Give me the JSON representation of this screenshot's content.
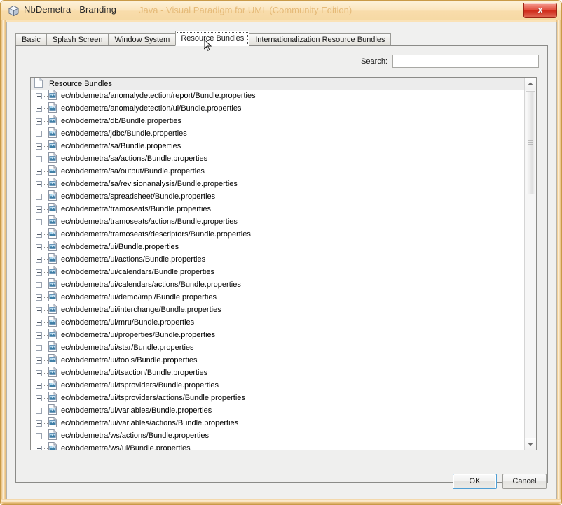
{
  "window": {
    "title": "NbDemetra - Branding",
    "title_icon": "cube-icon",
    "ghost_text": "Java - Visual Paradigm for UML (Community Edition)",
    "close_label": "x"
  },
  "tabs": [
    {
      "label": "Basic",
      "selected": false
    },
    {
      "label": "Splash Screen",
      "selected": false
    },
    {
      "label": "Window System",
      "selected": false
    },
    {
      "label": "Resource Bundles",
      "selected": true
    },
    {
      "label": "Internationalization Resource Bundles",
      "selected": false
    }
  ],
  "search": {
    "label": "Search:",
    "value": "",
    "placeholder": ""
  },
  "tree": {
    "root_label": "Resource Bundles",
    "root_icon": "document-icon",
    "child_icon": "properties-file-icon",
    "handle_icon": "plus-expand-icon",
    "items": [
      "ec/nbdemetra/anomalydetection/report/Bundle.properties",
      "ec/nbdemetra/anomalydetection/ui/Bundle.properties",
      "ec/nbdemetra/db/Bundle.properties",
      "ec/nbdemetra/jdbc/Bundle.properties",
      "ec/nbdemetra/sa/Bundle.properties",
      "ec/nbdemetra/sa/actions/Bundle.properties",
      "ec/nbdemetra/sa/output/Bundle.properties",
      "ec/nbdemetra/sa/revisionanalysis/Bundle.properties",
      "ec/nbdemetra/spreadsheet/Bundle.properties",
      "ec/nbdemetra/tramoseats/Bundle.properties",
      "ec/nbdemetra/tramoseats/actions/Bundle.properties",
      "ec/nbdemetra/tramoseats/descriptors/Bundle.properties",
      "ec/nbdemetra/ui/Bundle.properties",
      "ec/nbdemetra/ui/actions/Bundle.properties",
      "ec/nbdemetra/ui/calendars/Bundle.properties",
      "ec/nbdemetra/ui/calendars/actions/Bundle.properties",
      "ec/nbdemetra/ui/demo/impl/Bundle.properties",
      "ec/nbdemetra/ui/interchange/Bundle.properties",
      "ec/nbdemetra/ui/mru/Bundle.properties",
      "ec/nbdemetra/ui/properties/Bundle.properties",
      "ec/nbdemetra/ui/star/Bundle.properties",
      "ec/nbdemetra/ui/tools/Bundle.properties",
      "ec/nbdemetra/ui/tsaction/Bundle.properties",
      "ec/nbdemetra/ui/tsproviders/Bundle.properties",
      "ec/nbdemetra/ui/tsproviders/actions/Bundle.properties",
      "ec/nbdemetra/ui/variables/Bundle.properties",
      "ec/nbdemetra/ui/variables/actions/Bundle.properties",
      "ec/nbdemetra/ws/actions/Bundle.properties",
      "ec/nbdemetra/ws/ui/Bundle.properties"
    ]
  },
  "scrollbar": {
    "up_icon": "scroll-up-arrow-icon",
    "down_icon": "scroll-down-arrow-icon"
  },
  "buttons": {
    "ok": "OK",
    "cancel": "Cancel"
  },
  "colors": {
    "window_frame": "#f3cf92",
    "panel_bg": "#efefee",
    "list_bg": "#ffffff",
    "close_red": "#cf2a19",
    "default_button_border": "#4e9ed4"
  }
}
